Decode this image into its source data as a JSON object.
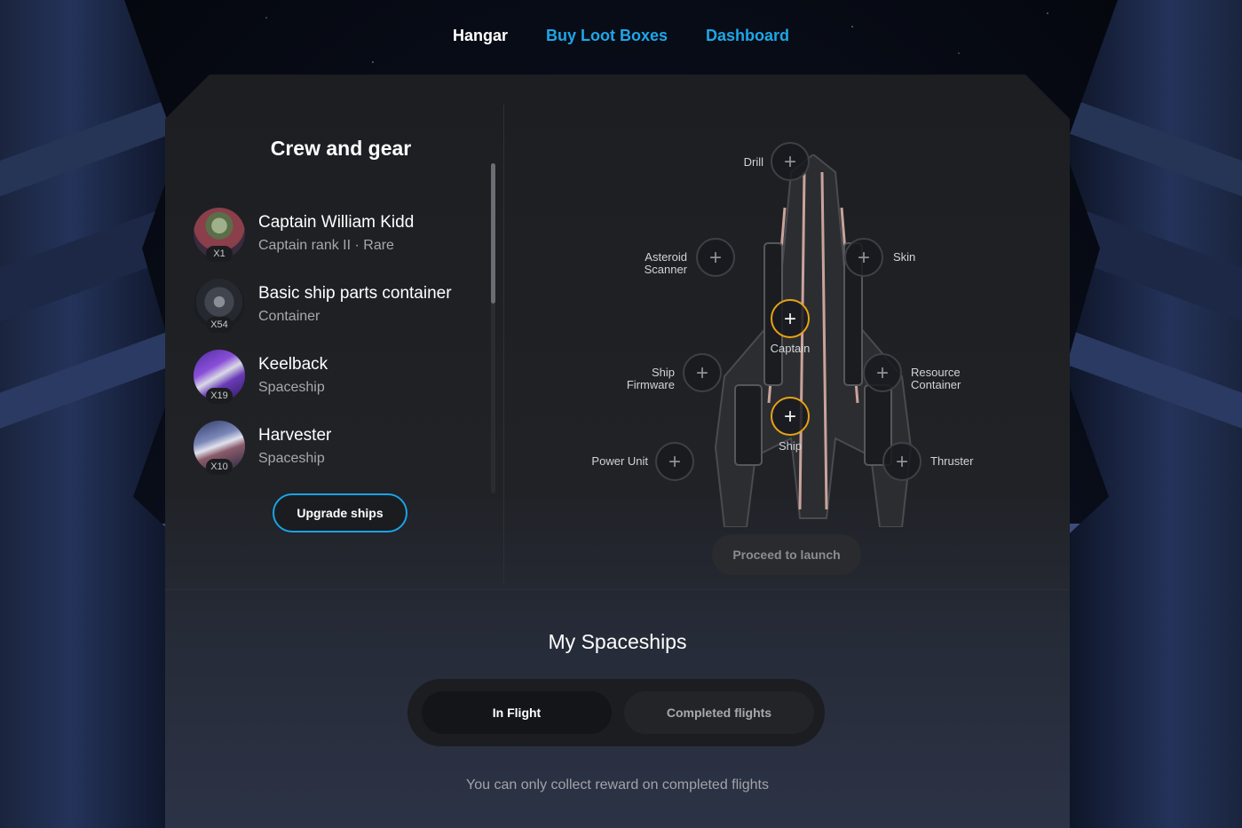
{
  "nav": {
    "items": [
      {
        "label": "Hangar",
        "active": true
      },
      {
        "label": "Buy Loot Boxes",
        "active": false
      },
      {
        "label": "Dashboard",
        "active": false
      }
    ]
  },
  "crew": {
    "title": "Crew and gear",
    "items": [
      {
        "name": "Captain William Kidd",
        "subtitle": "Captain rank II · Rare",
        "qty": "X1",
        "icon": "captain-avatar",
        "color": "#7a4b52"
      },
      {
        "name": "Basic ship parts container",
        "subtitle": "Container",
        "qty": "X54",
        "icon": "container-icon",
        "color": "#3a3f48"
      },
      {
        "name": "Keelback",
        "subtitle": "Spaceship",
        "qty": "X19",
        "icon": "keelback-ship-icon",
        "color": "#5a3aa8"
      },
      {
        "name": "Harvester",
        "subtitle": "Spaceship",
        "qty": "X10",
        "icon": "harvester-ship-icon",
        "color": "#4b5a8e"
      }
    ],
    "upgrade_label": "Upgrade ships"
  },
  "loadout": {
    "slots": {
      "drill": "Drill",
      "asteroid_scanner": "Asteroid Scanner",
      "skin": "Skin",
      "captain": "Captain",
      "ship_firmware": "Ship Firmware",
      "resource_container": "Resource Container",
      "ship": "Ship",
      "power_unit": "Power Unit",
      "thruster": "Thruster"
    },
    "launch_label": "Proceed to launch"
  },
  "spaceships": {
    "title": "My Spaceships",
    "tabs": [
      {
        "label": "In Flight",
        "active": true
      },
      {
        "label": "Completed flights",
        "active": false
      }
    ],
    "info": "You can only collect reward on completed flights"
  },
  "colors": {
    "accent": "#1ea6e8",
    "slot_highlight": "#e6a316"
  }
}
